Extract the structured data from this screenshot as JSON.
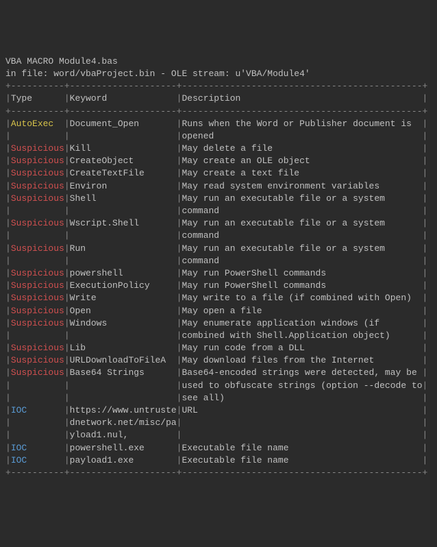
{
  "header": {
    "line1": "VBA MACRO Module4.bas",
    "line2": "in file: word/vbaProject.bin - OLE stream: u'VBA/Module4'"
  },
  "columns": {
    "type": "Type",
    "keyword": "Keyword",
    "description": "Description"
  },
  "separator_top": "+----------+--------------------+---------------------------------------------+",
  "separator_mid": "+----------+--------------------+---------------------------------------------+",
  "separator_bot": "+----------+--------------------+---------------------------------------------+",
  "rows": [
    {
      "type": "AutoExec",
      "type_class": "autoexec",
      "keyword": [
        "Document_Open"
      ],
      "desc": [
        "Runs when the Word or Publisher document is",
        "opened"
      ]
    },
    {
      "type": "Suspicious",
      "type_class": "suspicious",
      "keyword": [
        "Kill"
      ],
      "desc": [
        "May delete a file"
      ]
    },
    {
      "type": "Suspicious",
      "type_class": "suspicious",
      "keyword": [
        "CreateObject"
      ],
      "desc": [
        "May create an OLE object"
      ]
    },
    {
      "type": "Suspicious",
      "type_class": "suspicious",
      "keyword": [
        "CreateTextFile"
      ],
      "desc": [
        "May create a text file"
      ]
    },
    {
      "type": "Suspicious",
      "type_class": "suspicious",
      "keyword": [
        "Environ"
      ],
      "desc": [
        "May read system environment variables"
      ]
    },
    {
      "type": "Suspicious",
      "type_class": "suspicious",
      "keyword": [
        "Shell"
      ],
      "desc": [
        "May run an executable file or a system",
        "command"
      ]
    },
    {
      "type": "Suspicious",
      "type_class": "suspicious",
      "keyword": [
        "Wscript.Shell"
      ],
      "desc": [
        "May run an executable file or a system",
        "command"
      ]
    },
    {
      "type": "Suspicious",
      "type_class": "suspicious",
      "keyword": [
        "Run"
      ],
      "desc": [
        "May run an executable file or a system",
        "command"
      ]
    },
    {
      "type": "Suspicious",
      "type_class": "suspicious",
      "keyword": [
        "powershell"
      ],
      "desc": [
        "May run PowerShell commands"
      ]
    },
    {
      "type": "Suspicious",
      "type_class": "suspicious",
      "keyword": [
        "ExecutionPolicy"
      ],
      "desc": [
        "May run PowerShell commands"
      ]
    },
    {
      "type": "Suspicious",
      "type_class": "suspicious",
      "keyword": [
        "Write"
      ],
      "desc": [
        "May write to a file (if combined with Open)"
      ]
    },
    {
      "type": "Suspicious",
      "type_class": "suspicious",
      "keyword": [
        "Open"
      ],
      "desc": [
        "May open a file"
      ]
    },
    {
      "type": "Suspicious",
      "type_class": "suspicious",
      "keyword": [
        "Windows"
      ],
      "desc": [
        "May enumerate application windows (if",
        "combined with Shell.Application object)"
      ]
    },
    {
      "type": "Suspicious",
      "type_class": "suspicious",
      "keyword": [
        "Lib"
      ],
      "desc": [
        "May run code from a DLL"
      ]
    },
    {
      "type": "Suspicious",
      "type_class": "suspicious",
      "keyword": [
        "URLDownloadToFileA"
      ],
      "desc": [
        "May download files from the Internet"
      ]
    },
    {
      "type": "Suspicious",
      "type_class": "suspicious",
      "keyword": [
        "Base64 Strings"
      ],
      "desc": [
        "Base64-encoded strings were detected, may be",
        "used to obfuscate strings (option --decode to",
        "see all)"
      ]
    },
    {
      "type": "IOC",
      "type_class": "ioc",
      "keyword": [
        "https://www.untruste",
        "dnetwork.net/misc/pa",
        "yload1.nul,"
      ],
      "desc": [
        "URL"
      ]
    },
    {
      "type": "IOC",
      "type_class": "ioc",
      "keyword": [
        "powershell.exe"
      ],
      "desc": [
        "Executable file name"
      ]
    },
    {
      "type": "IOC",
      "type_class": "ioc",
      "keyword": [
        "payload1.exe"
      ],
      "desc": [
        "Executable file name"
      ]
    }
  ]
}
